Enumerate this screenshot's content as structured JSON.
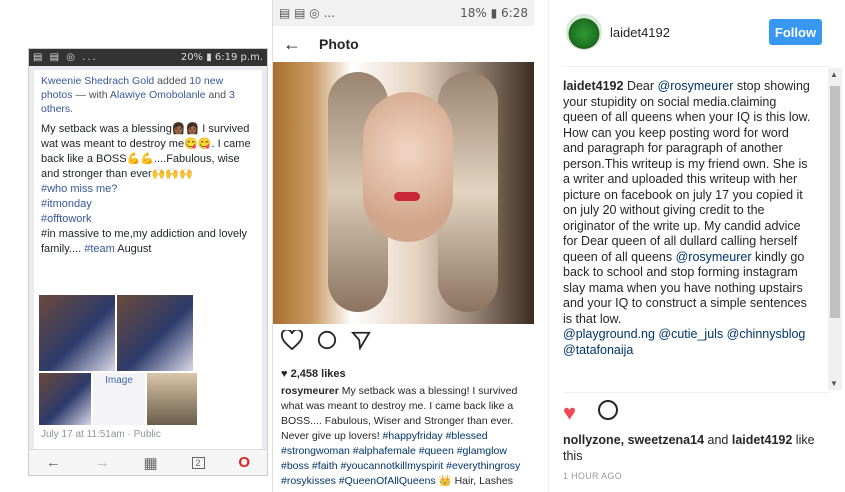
{
  "left_phone": {
    "status_time": "20% ▮ 6:19 p.m.",
    "status_icons": "▤ ▤ ◎ ...",
    "header_author": "Kweenie Shedrach Gold",
    "header_added": "added",
    "header_photos": "10 new photos",
    "header_with": "— with",
    "header_tag1": "Alawiye Omobolanle",
    "header_and": "and",
    "header_others": "3 others.",
    "post_text": "My setback was a blessing👩🏾👩🏾 I survived wat was meant to destroy me😋😋. I came back like a BOSS💪💪....Fabulous, wise and stronger than ever🙌🙌🙌",
    "tags": [
      "#who miss me?",
      "#itmonday",
      "#offtowork"
    ],
    "tail_text1": "#in massive to me,my addiction and lovely family.... ",
    "tail_tag": "#team",
    "tail_text2": " August",
    "image_label": "Image",
    "timestamp": "July 17 at 11:51am · Public",
    "nav_icons": [
      "←",
      "→",
      "▦",
      "2",
      "O"
    ]
  },
  "middle_phone": {
    "status_left": "▤ ▤ ◎ ...",
    "status_right": "18% ▮ 6:28",
    "title": "Photo",
    "back_icon": "←",
    "likes": "2,458 likes",
    "caption_user": "rosymeurer",
    "caption_text": " My setback was a blessing! I survived what was meant to destroy me. I came back like a BOSS.... Fabulous, Wiser and Stronger than ever. Never give up lovers! ",
    "caption_tags": "#happyfriday #blessed #strongwoman #alphafemale #queen #glamglow #boss #faith #youcannotkillmyspirit #everythingrosy #rosykisses #QueenOfAllQueens",
    "caption_tail": " 👑 Hair, Lashes"
  },
  "right_panel": {
    "username": "laidet4192",
    "follow_label": "Follow",
    "comment_user": "laidet4192",
    "comment_pre": " Dear ",
    "comment_mention": "@rosymeurer",
    "comment_body": " stop showing your stupidity on social media.claiming queen of all queens when your IQ is this low. How can you keep posting word for word and paragraph for paragraph of another person.This writeup is my friend own. She is a writer and uploaded this writeup with her picture on facebook on july 17 you copied it on july 20 without giving credit to the originator of the write up. My candid advice for Dear queen of all dullard calling herself queen of all queens ",
    "comment_mention2": "@rosymeurer",
    "comment_body2": " kindly go back to school and stop forming instagram slay mama when you have nothing upstairs and your IQ to construct a simple sentences is that low.",
    "comment_tags": "@playground.ng @cutie_juls @chinnysblog @tatafonaija",
    "liked_by_users": "nollyzone, sweetzena14",
    "liked_by_and": " and ",
    "liked_by_last": "laidet4192",
    "liked_by_suffix": " like this",
    "time_ago": "1 HOUR AGO"
  },
  "colors": {
    "follow_blue": "#3897f0",
    "heart_red": "#ed4956",
    "fb_link": "#365899"
  }
}
